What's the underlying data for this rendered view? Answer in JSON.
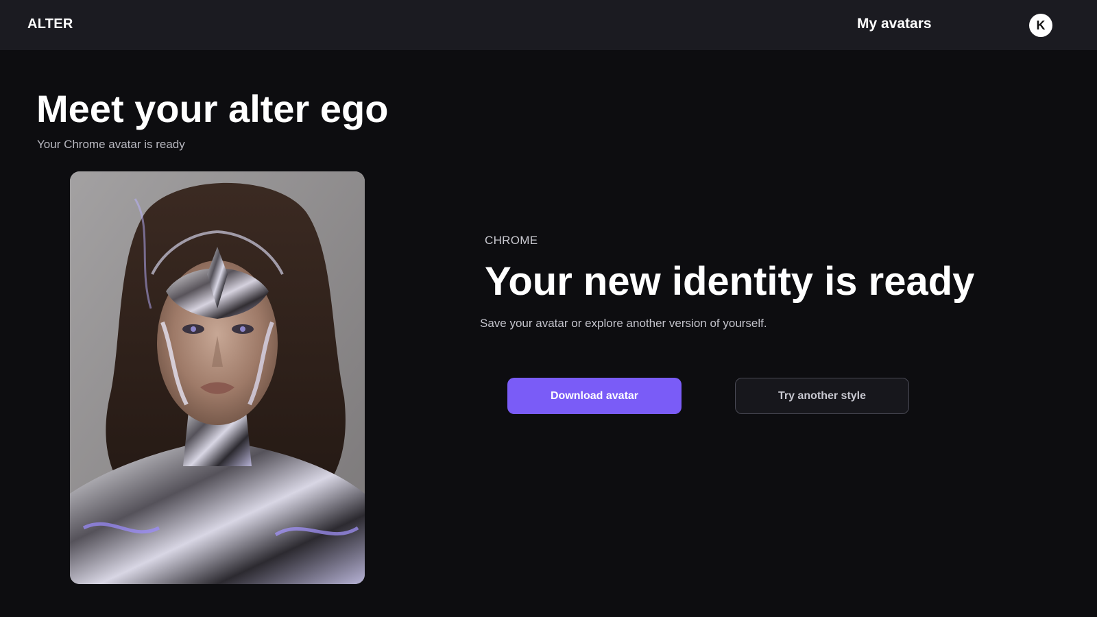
{
  "header": {
    "logo": "ALTER",
    "nav_link": "My avatars",
    "user_initial": "K"
  },
  "intro": {
    "title": "Meet your alter ego",
    "subtitle": "Your Chrome avatar is ready"
  },
  "avatar": {
    "style": "Chrome",
    "image_icon": "chrome-avatar-portrait"
  },
  "result": {
    "tag": "CHROME",
    "title": "Your new identity is ready",
    "description": "Save your avatar or explore another version of yourself."
  },
  "actions": {
    "primary_label": "Download avatar",
    "secondary_label": "Try another style"
  },
  "colors": {
    "background": "#0d0d10",
    "header": "#1b1b21",
    "accent": "#7a5cf7"
  }
}
